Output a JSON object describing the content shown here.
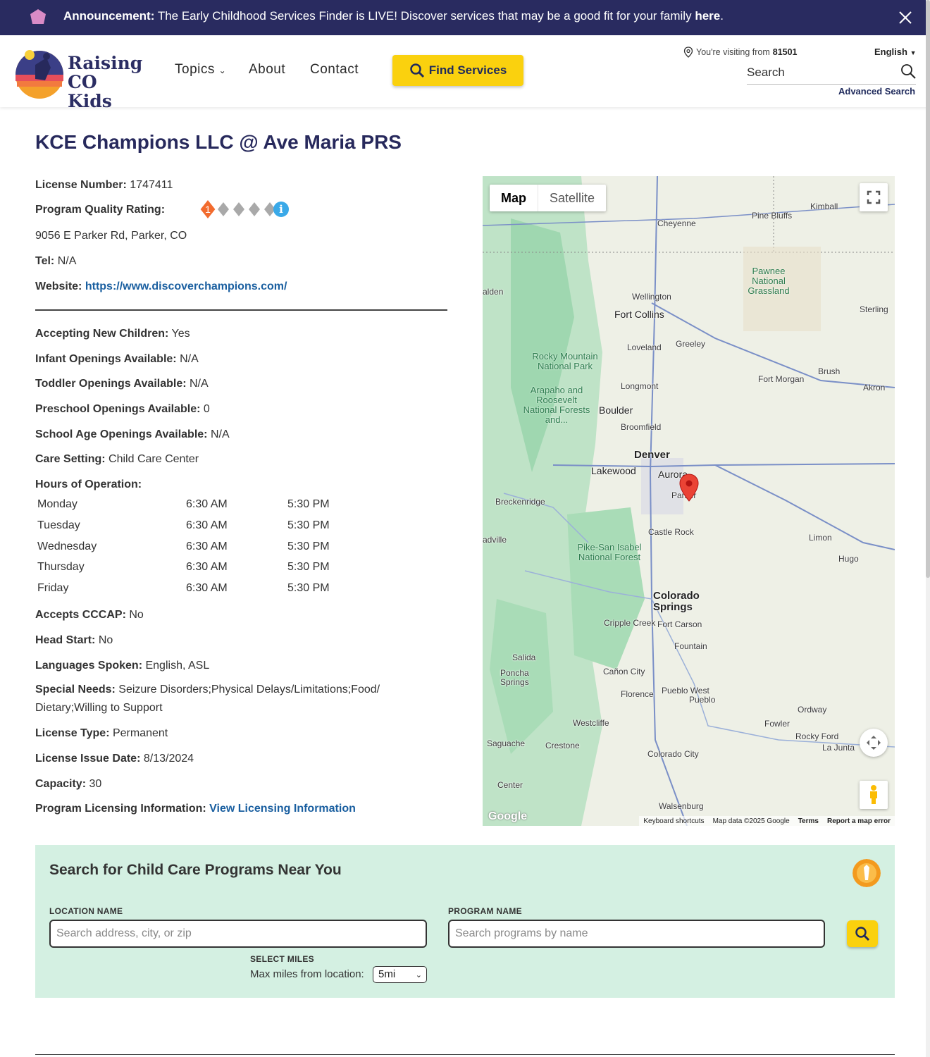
{
  "announcement": {
    "label": "Announcement:",
    "message": "The Early Childhood Services Finder is LIVE! Discover services that may be a good fit for your family",
    "link": "here",
    "end": "."
  },
  "header": {
    "logo_line1": "Raising",
    "logo_line2": "CO Kids",
    "nav": [
      "Topics",
      "About",
      "Contact"
    ],
    "find_services": "Find Services",
    "visiting_prefix": "You're visiting from",
    "visiting_zip": "81501",
    "language": "English",
    "search_placeholder": "Search",
    "advanced_search": "Advanced Search"
  },
  "program": {
    "name": "KCE Champions LLC @ Ave Maria PRS",
    "license_number_label": "License Number:",
    "license_number": "1747411",
    "quality_label": "Program Quality Rating:",
    "quality_rating": 1,
    "quality_max": 5,
    "address": "9056 E Parker Rd, Parker, CO",
    "tel_label": "Tel:",
    "tel": "N/A",
    "website_label": "Website:",
    "website": "https://www.discoverchampions.com/",
    "accepting_label": "Accepting New Children:",
    "accepting": "Yes",
    "infant_label": "Infant Openings Available:",
    "infant": "N/A",
    "toddler_label": "Toddler Openings Available:",
    "toddler": "N/A",
    "preschool_label": "Preschool Openings Available:",
    "preschool": "0",
    "school_age_label": "School Age Openings Available:",
    "school_age": "N/A",
    "care_setting_label": "Care Setting:",
    "care_setting": "Child Care Center",
    "hours_label": "Hours of Operation:",
    "hours": [
      {
        "day": "Monday",
        "open": "6:30 AM",
        "close": "5:30 PM"
      },
      {
        "day": "Tuesday",
        "open": "6:30 AM",
        "close": "5:30 PM"
      },
      {
        "day": "Wednesday",
        "open": "6:30 AM",
        "close": "5:30 PM"
      },
      {
        "day": "Thursday",
        "open": "6:30 AM",
        "close": "5:30 PM"
      },
      {
        "day": "Friday",
        "open": "6:30 AM",
        "close": "5:30 PM"
      }
    ],
    "cccap_label": "Accepts CCCAP:",
    "cccap": "No",
    "head_start_label": "Head Start:",
    "head_start": "No",
    "languages_label": "Languages Spoken:",
    "languages": "English, ASL",
    "special_needs_label": "Special Needs:",
    "special_needs": "Seizure Disorders;Physical Delays/Limitations;Food/ Dietary;Willing to Support",
    "license_type_label": "License Type:",
    "license_type": "Permanent",
    "license_issue_label": "License Issue Date:",
    "license_issue": "8/13/2024",
    "capacity_label": "Capacity:",
    "capacity": "30",
    "licensing_info_label": "Program Licensing Information:",
    "licensing_info_link": "View Licensing Information"
  },
  "map": {
    "tab_map": "Map",
    "tab_satellite": "Satellite",
    "cities": {
      "cheyenne": "Cheyenne",
      "kimball": "Kimball",
      "pine_bluffs": "Pine Bluffs",
      "wellington": "Wellington",
      "fort_collins": "Fort Collins",
      "loveland": "Loveland",
      "greeley": "Greeley",
      "sterling": "Sterling",
      "longmont": "Longmont",
      "boulder": "Boulder",
      "broomfield": "Broomfield",
      "denver": "Denver",
      "lakewood": "Lakewood",
      "aurora": "Aurora",
      "parker": "Parker",
      "castle_rock": "Castle Rock",
      "breckenridge": "Breckenridge",
      "brush": "Brush",
      "fort_morgan": "Fort Morgan",
      "akron": "Akron",
      "limon": "Limon",
      "hugo": "Hugo",
      "colorado_springs": "Colorado Springs",
      "cripple_creek": "Cripple Creek",
      "fort_carson": "Fort Carson",
      "fountain": "Fountain",
      "salida": "Salida",
      "poncha_springs": "Poncha Springs",
      "canon_city": "Cañon City",
      "florence": "Florence",
      "pueblo_west": "Pueblo West",
      "pueblo": "Pueblo",
      "ordway": "Ordway",
      "fowler": "Fowler",
      "westcliffe": "Westcliffe",
      "saguache": "Saguache",
      "crestone": "Crestone",
      "colorado_city": "Colorado City",
      "rocky_ford": "Rocky Ford",
      "la_junta": "La Junta",
      "center": "Center",
      "walsenburg": "Walsenburg",
      "alden": "alden",
      "adville": "adville"
    },
    "parks": {
      "pawnee": "Pawnee National Grassland",
      "rocky": "Rocky Mountain National Park",
      "arapaho": "Arapaho and Roosevelt National Forests and...",
      "pike": "Pike-San Isabel National Forest"
    },
    "google": "Google",
    "footer": [
      "Keyboard shortcuts",
      "Map data ©2025 Google",
      "Terms",
      "Report a map error"
    ]
  },
  "search_panel": {
    "title": "Search for Child Care Programs Near You",
    "location_label": "LOCATION NAME",
    "location_placeholder": "Search address, city, or zip",
    "program_label": "PROGRAM NAME",
    "program_placeholder": "Search programs by name",
    "miles_label": "SELECT MILES",
    "miles_text": "Max miles from location:",
    "miles_value": "5mi"
  },
  "colors": {
    "brand_navy": "#292b60",
    "accent_yellow": "#fad10e",
    "link_blue": "#1a5fa0",
    "panel_green": "#d4f0e2",
    "rating_orange": "#f26b2e"
  }
}
